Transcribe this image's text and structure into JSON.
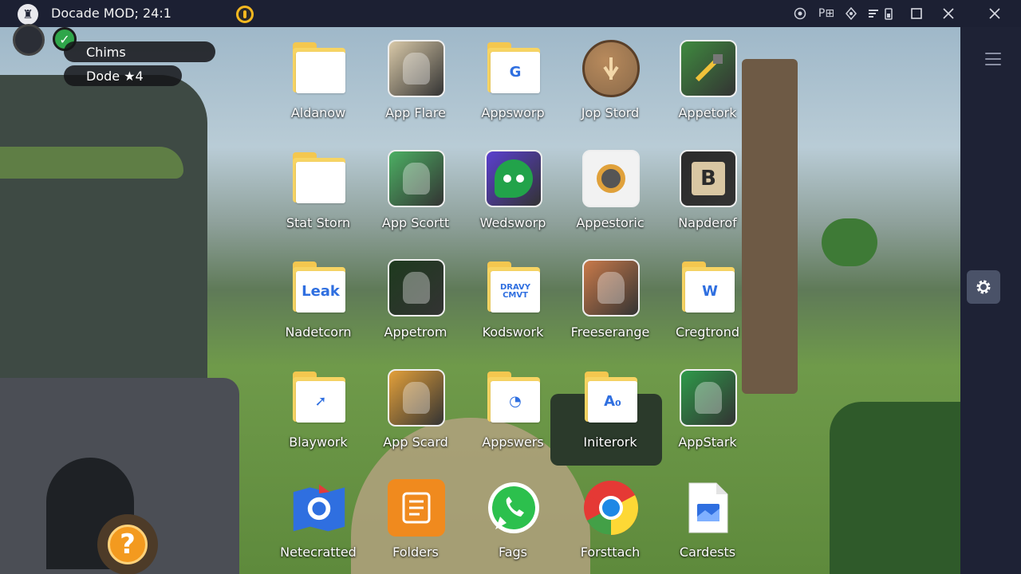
{
  "titlebar": {
    "title": "Docade MOD; 24:1",
    "logo_icon": "game-logo-icon",
    "right_icons": [
      "target-icon",
      "screen-record-icon",
      "location-icon",
      "signal-icon",
      "battery-icon"
    ],
    "right_text": "P⊞"
  },
  "hud": {
    "pill1": "Chims",
    "pill2": "Dode ★4"
  },
  "apps": [
    {
      "label": "Aldanow",
      "icon": "folder-icon",
      "kind": "folder",
      "inner": ""
    },
    {
      "label": "App Flare",
      "icon": "app-flare-icon",
      "kind": "art",
      "color": "#d9c9a8"
    },
    {
      "label": "Appsworp",
      "icon": "folder-google-icon",
      "kind": "folder",
      "inner": "G"
    },
    {
      "label": "Jop Stord",
      "icon": "jop-stord-icon",
      "kind": "round",
      "color": "#8a6a4a"
    },
    {
      "label": "Appetork",
      "icon": "appetork-icon",
      "kind": "art",
      "color": "#3f8a3f"
    },
    {
      "label": "Stat Storn",
      "icon": "folder-icon",
      "kind": "folder",
      "inner": ""
    },
    {
      "label": "App Scortt",
      "icon": "app-scortt-icon",
      "kind": "art",
      "color": "#4caf63"
    },
    {
      "label": "Wedsworp",
      "icon": "wedsworp-icon",
      "kind": "art",
      "color": "#5a3fcf"
    },
    {
      "label": "Appestoric",
      "icon": "appestoric-icon",
      "kind": "art",
      "color": "#f3f3f3"
    },
    {
      "label": "Napderof",
      "icon": "napderof-icon",
      "kind": "art",
      "color": "#2b2b2b"
    },
    {
      "label": "Nadetcorn",
      "icon": "folder-leak-icon",
      "kind": "folder",
      "inner": "Leak"
    },
    {
      "label": "Appetrom",
      "icon": "appetrom-icon",
      "kind": "art",
      "color": "#1e3a1e"
    },
    {
      "label": "Kodswork",
      "icon": "folder-kodswork-icon",
      "kind": "folder",
      "inner": "DRAVY CMVT"
    },
    {
      "label": "Freeserange",
      "icon": "freeserange-icon",
      "kind": "art",
      "color": "#c97a4a"
    },
    {
      "label": "Cregtrond",
      "icon": "folder-cregtrond-icon",
      "kind": "folder",
      "inner": "W"
    },
    {
      "label": "Blaywork",
      "icon": "folder-blaywork-icon",
      "kind": "folder",
      "inner": "➚"
    },
    {
      "label": "App Scard",
      "icon": "app-scard-icon",
      "kind": "art",
      "color": "#e3a03a"
    },
    {
      "label": "Appswers",
      "icon": "folder-appswers-icon",
      "kind": "folder",
      "inner": "◔"
    },
    {
      "label": "Initerork",
      "icon": "folder-initerork-icon",
      "kind": "folder",
      "inner": "A₀"
    },
    {
      "label": "AppStark",
      "icon": "appstark-icon",
      "kind": "art",
      "color": "#2e9a4a"
    },
    {
      "label": "Netecratted",
      "icon": "netecratted-icon",
      "kind": "special",
      "color": "#2f6fe0"
    },
    {
      "label": "Folders",
      "icon": "folders-notes-icon",
      "kind": "special",
      "color": "#f08a1e"
    },
    {
      "label": "Fags",
      "icon": "whatsapp-icon",
      "kind": "special",
      "color": "#2cc04d"
    },
    {
      "label": "Forsttach",
      "icon": "chrome-icon",
      "kind": "special",
      "color": "#ffffff"
    },
    {
      "label": "Cardests",
      "icon": "docs-file-icon",
      "kind": "special",
      "color": "#ffffff"
    }
  ],
  "side": {
    "menu_icon": "hamburger-menu-icon",
    "settings_icon": "gear-icon"
  },
  "help_label": "?"
}
